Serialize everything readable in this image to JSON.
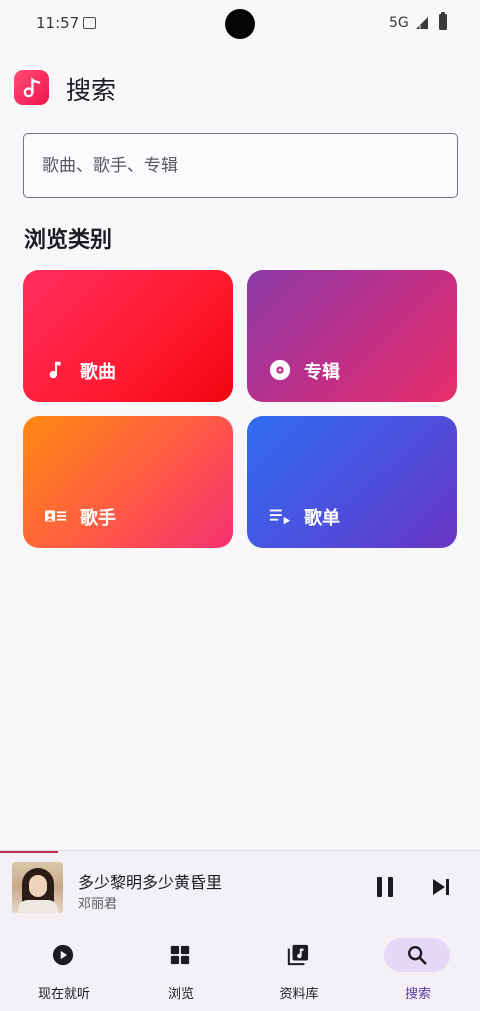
{
  "status_bar": {
    "time": "11:57",
    "network": "5G"
  },
  "app_bar": {
    "title": "搜索",
    "logo_icon": "music-note-app-logo"
  },
  "search": {
    "placeholder": "歌曲、歌手、专辑",
    "value": ""
  },
  "browse": {
    "section_title": "浏览类别",
    "categories": [
      {
        "label": "歌曲",
        "icon": "music-note-icon"
      },
      {
        "label": "专辑",
        "icon": "album-disc-icon"
      },
      {
        "label": "歌手",
        "icon": "artist-card-icon"
      },
      {
        "label": "歌单",
        "icon": "playlist-icon"
      }
    ]
  },
  "mini_player": {
    "title": "多少黎明多少黄昏里",
    "artist": "邓丽君",
    "progress": 0.12,
    "state": "playing"
  },
  "bottom_nav": {
    "items": [
      {
        "label": "现在就听",
        "icon": "play-circle-icon",
        "active": false
      },
      {
        "label": "浏览",
        "icon": "grid-icon",
        "active": false
      },
      {
        "label": "资料库",
        "icon": "library-music-icon",
        "active": false
      },
      {
        "label": "搜索",
        "icon": "search-icon",
        "active": true
      }
    ]
  },
  "colors": {
    "accent": "#5b3fa8",
    "active_pill": "#e6d9f7",
    "brand": "#f0144e"
  }
}
